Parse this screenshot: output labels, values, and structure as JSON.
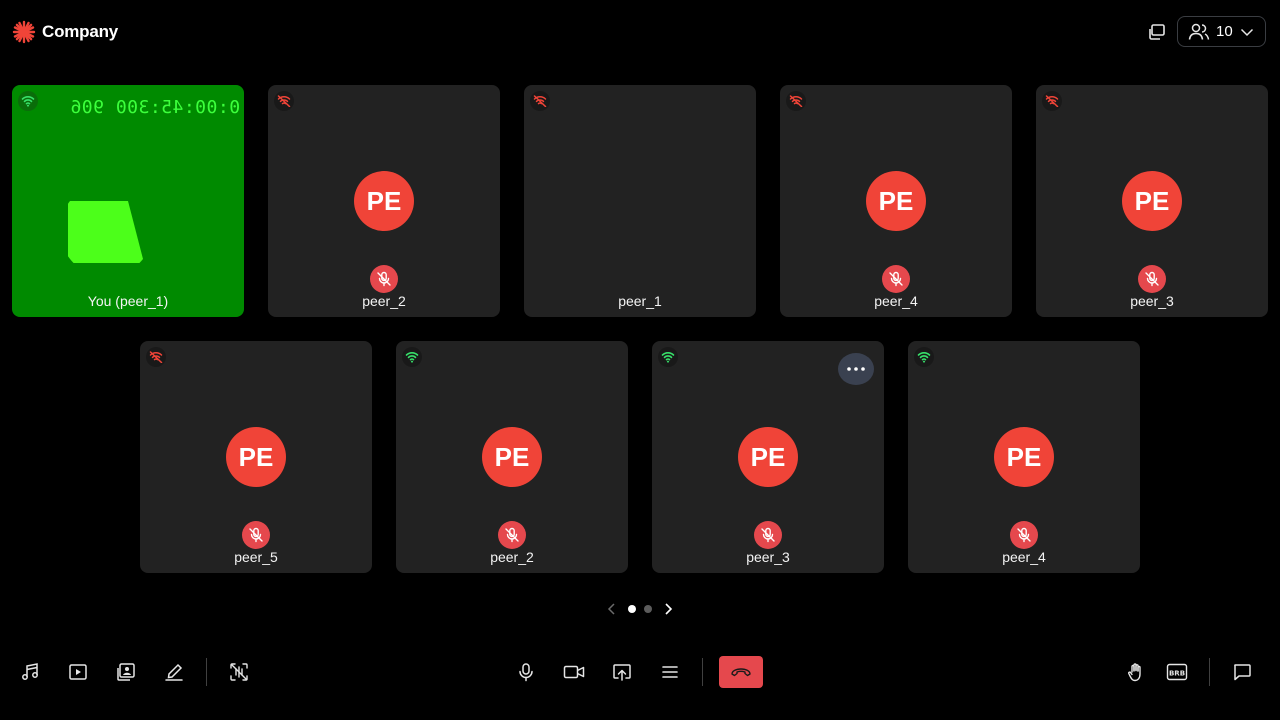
{
  "app": {
    "brand_name": "Company",
    "brand_icon": "starburst-icon",
    "accent": "#f04438"
  },
  "header": {
    "participants_count": "10"
  },
  "tiles": [
    {
      "name": "You (peer_1)",
      "network": "good",
      "local": true,
      "timecode": "0:00:45:300 906"
    },
    {
      "name": "peer_2",
      "network": "poor",
      "avatar": "PE",
      "muted": true
    },
    {
      "name": "peer_1",
      "network": "poor"
    },
    {
      "name": "peer_4",
      "network": "poor",
      "avatar": "PE",
      "muted": true
    },
    {
      "name": "peer_3",
      "network": "poor",
      "avatar": "PE",
      "muted": true
    },
    {
      "name": "peer_5",
      "network": "poor",
      "avatar": "PE",
      "muted": true
    },
    {
      "name": "peer_2",
      "network": "good",
      "avatar": "PE",
      "muted": true
    },
    {
      "name": "peer_3",
      "network": "good",
      "avatar": "PE",
      "muted": true,
      "menu": "more-options"
    },
    {
      "name": "peer_4",
      "network": "good",
      "avatar": "PE",
      "muted": true
    }
  ],
  "pagination": {
    "pages": 2,
    "current": 1
  },
  "footer": {
    "left_controls": [
      "music-icon",
      "video-playlist-icon",
      "virtual-background-icon",
      "whiteboard-pen-icon",
      "noise-filter-icon"
    ],
    "center_controls": [
      "microphone-icon",
      "camera-icon",
      "screen-share-icon",
      "menu-icon",
      "leave-call-icon"
    ],
    "right_controls": [
      "raise-hand-icon",
      "brb-icon",
      "chat-icon"
    ],
    "leave_color": "#e5484d"
  }
}
